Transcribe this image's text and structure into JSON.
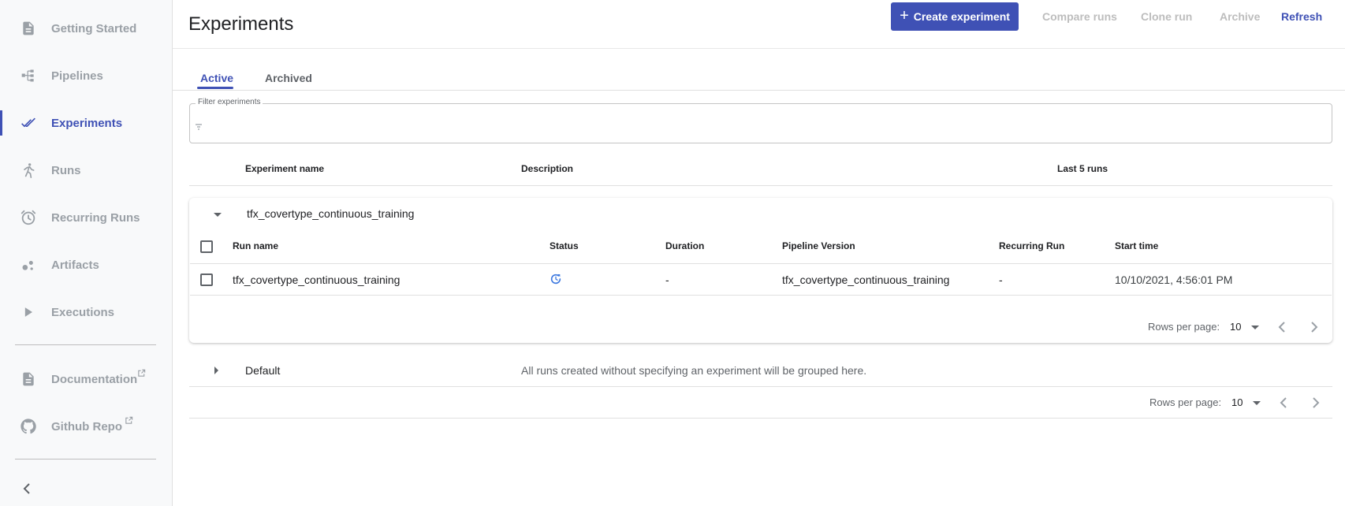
{
  "sidebar": {
    "items": [
      {
        "label": "Getting Started",
        "icon": "document-icon"
      },
      {
        "label": "Pipelines",
        "icon": "pipeline-icon"
      },
      {
        "label": "Experiments",
        "icon": "double-check-icon"
      },
      {
        "label": "Runs",
        "icon": "running-person-icon"
      },
      {
        "label": "Recurring Runs",
        "icon": "alarm-clock-icon"
      },
      {
        "label": "Artifacts",
        "icon": "bubbles-icon"
      },
      {
        "label": "Executions",
        "icon": "play-icon"
      }
    ],
    "active": "Experiments",
    "links": [
      {
        "label": "Documentation",
        "icon": "document-icon"
      },
      {
        "label": "Github Repo",
        "icon": "github-icon"
      }
    ]
  },
  "header": {
    "title": "Experiments",
    "create_label": "Create experiment",
    "compare_label": "Compare runs",
    "clone_label": "Clone run",
    "archive_label": "Archive",
    "refresh_label": "Refresh"
  },
  "tabs": {
    "active": "Active",
    "archived": "Archived"
  },
  "filter": {
    "label": "Filter experiments",
    "value": ""
  },
  "experiments_table": {
    "columns": [
      "Experiment name",
      "Description",
      "Last 5 runs"
    ],
    "expanded_experiment": {
      "name": "tfx_covertype_continuous_training",
      "run_columns": [
        "Run name",
        "Status",
        "Duration",
        "Pipeline Version",
        "Recurring Run",
        "Start time"
      ],
      "runs": [
        {
          "name": "tfx_covertype_continuous_training",
          "status": "running",
          "duration": "-",
          "pipeline_version": "tfx_covertype_continuous_training",
          "recurring_run": "-",
          "start_time": "10/10/2021, 4:56:01 PM"
        }
      ],
      "pager": {
        "label": "Rows per page:",
        "value": "10"
      }
    },
    "collapsed_experiment": {
      "name": "Default",
      "description": "All runs created without specifying an experiment will be grouped here."
    },
    "pager": {
      "label": "Rows per page:",
      "value": "10"
    }
  },
  "colors": {
    "accent": "#3f51b5",
    "muted": "#9aa0a6",
    "status_running": "#3f7ae0"
  }
}
